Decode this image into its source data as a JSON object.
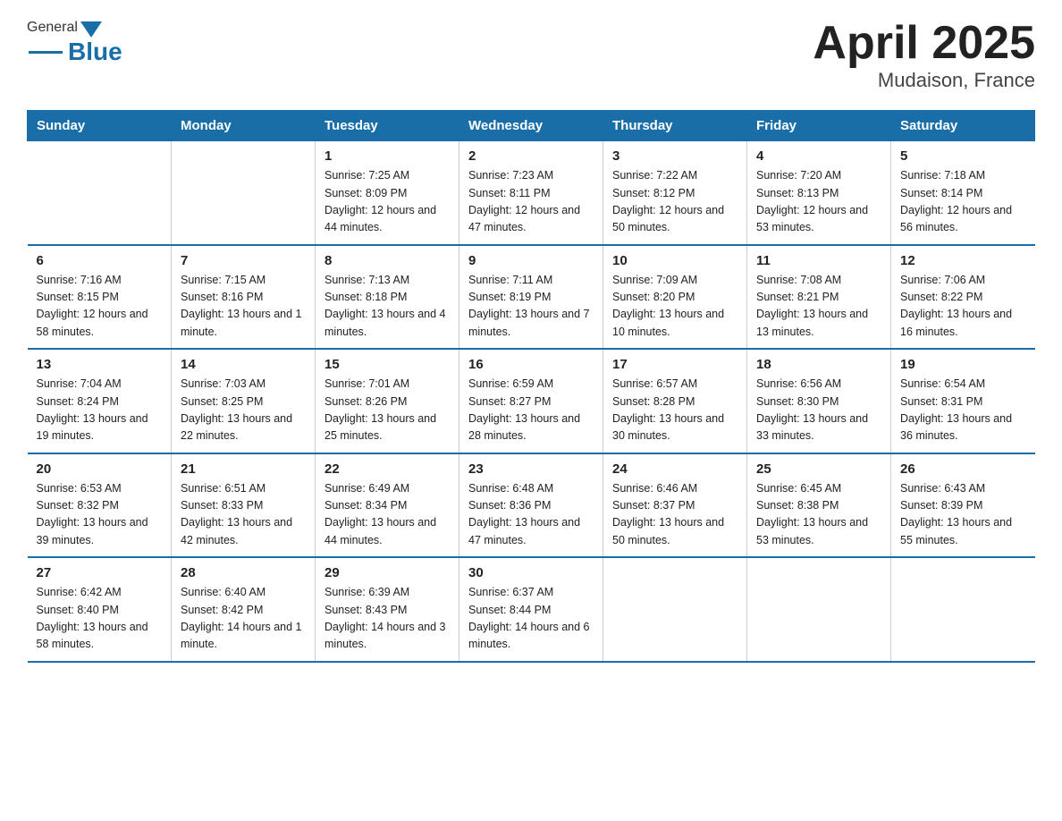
{
  "logo": {
    "general": "General",
    "blue": "Blue"
  },
  "title": "April 2025",
  "subtitle": "Mudaison, France",
  "headers": [
    "Sunday",
    "Monday",
    "Tuesday",
    "Wednesday",
    "Thursday",
    "Friday",
    "Saturday"
  ],
  "weeks": [
    [
      {
        "day": "",
        "info": ""
      },
      {
        "day": "",
        "info": ""
      },
      {
        "day": "1",
        "info": "Sunrise: 7:25 AM\nSunset: 8:09 PM\nDaylight: 12 hours\nand 44 minutes."
      },
      {
        "day": "2",
        "info": "Sunrise: 7:23 AM\nSunset: 8:11 PM\nDaylight: 12 hours\nand 47 minutes."
      },
      {
        "day": "3",
        "info": "Sunrise: 7:22 AM\nSunset: 8:12 PM\nDaylight: 12 hours\nand 50 minutes."
      },
      {
        "day": "4",
        "info": "Sunrise: 7:20 AM\nSunset: 8:13 PM\nDaylight: 12 hours\nand 53 minutes."
      },
      {
        "day": "5",
        "info": "Sunrise: 7:18 AM\nSunset: 8:14 PM\nDaylight: 12 hours\nand 56 minutes."
      }
    ],
    [
      {
        "day": "6",
        "info": "Sunrise: 7:16 AM\nSunset: 8:15 PM\nDaylight: 12 hours\nand 58 minutes."
      },
      {
        "day": "7",
        "info": "Sunrise: 7:15 AM\nSunset: 8:16 PM\nDaylight: 13 hours\nand 1 minute."
      },
      {
        "day": "8",
        "info": "Sunrise: 7:13 AM\nSunset: 8:18 PM\nDaylight: 13 hours\nand 4 minutes."
      },
      {
        "day": "9",
        "info": "Sunrise: 7:11 AM\nSunset: 8:19 PM\nDaylight: 13 hours\nand 7 minutes."
      },
      {
        "day": "10",
        "info": "Sunrise: 7:09 AM\nSunset: 8:20 PM\nDaylight: 13 hours\nand 10 minutes."
      },
      {
        "day": "11",
        "info": "Sunrise: 7:08 AM\nSunset: 8:21 PM\nDaylight: 13 hours\nand 13 minutes."
      },
      {
        "day": "12",
        "info": "Sunrise: 7:06 AM\nSunset: 8:22 PM\nDaylight: 13 hours\nand 16 minutes."
      }
    ],
    [
      {
        "day": "13",
        "info": "Sunrise: 7:04 AM\nSunset: 8:24 PM\nDaylight: 13 hours\nand 19 minutes."
      },
      {
        "day": "14",
        "info": "Sunrise: 7:03 AM\nSunset: 8:25 PM\nDaylight: 13 hours\nand 22 minutes."
      },
      {
        "day": "15",
        "info": "Sunrise: 7:01 AM\nSunset: 8:26 PM\nDaylight: 13 hours\nand 25 minutes."
      },
      {
        "day": "16",
        "info": "Sunrise: 6:59 AM\nSunset: 8:27 PM\nDaylight: 13 hours\nand 28 minutes."
      },
      {
        "day": "17",
        "info": "Sunrise: 6:57 AM\nSunset: 8:28 PM\nDaylight: 13 hours\nand 30 minutes."
      },
      {
        "day": "18",
        "info": "Sunrise: 6:56 AM\nSunset: 8:30 PM\nDaylight: 13 hours\nand 33 minutes."
      },
      {
        "day": "19",
        "info": "Sunrise: 6:54 AM\nSunset: 8:31 PM\nDaylight: 13 hours\nand 36 minutes."
      }
    ],
    [
      {
        "day": "20",
        "info": "Sunrise: 6:53 AM\nSunset: 8:32 PM\nDaylight: 13 hours\nand 39 minutes."
      },
      {
        "day": "21",
        "info": "Sunrise: 6:51 AM\nSunset: 8:33 PM\nDaylight: 13 hours\nand 42 minutes."
      },
      {
        "day": "22",
        "info": "Sunrise: 6:49 AM\nSunset: 8:34 PM\nDaylight: 13 hours\nand 44 minutes."
      },
      {
        "day": "23",
        "info": "Sunrise: 6:48 AM\nSunset: 8:36 PM\nDaylight: 13 hours\nand 47 minutes."
      },
      {
        "day": "24",
        "info": "Sunrise: 6:46 AM\nSunset: 8:37 PM\nDaylight: 13 hours\nand 50 minutes."
      },
      {
        "day": "25",
        "info": "Sunrise: 6:45 AM\nSunset: 8:38 PM\nDaylight: 13 hours\nand 53 minutes."
      },
      {
        "day": "26",
        "info": "Sunrise: 6:43 AM\nSunset: 8:39 PM\nDaylight: 13 hours\nand 55 minutes."
      }
    ],
    [
      {
        "day": "27",
        "info": "Sunrise: 6:42 AM\nSunset: 8:40 PM\nDaylight: 13 hours\nand 58 minutes."
      },
      {
        "day": "28",
        "info": "Sunrise: 6:40 AM\nSunset: 8:42 PM\nDaylight: 14 hours\nand 1 minute."
      },
      {
        "day": "29",
        "info": "Sunrise: 6:39 AM\nSunset: 8:43 PM\nDaylight: 14 hours\nand 3 minutes."
      },
      {
        "day": "30",
        "info": "Sunrise: 6:37 AM\nSunset: 8:44 PM\nDaylight: 14 hours\nand 6 minutes."
      },
      {
        "day": "",
        "info": ""
      },
      {
        "day": "",
        "info": ""
      },
      {
        "day": "",
        "info": ""
      }
    ]
  ]
}
